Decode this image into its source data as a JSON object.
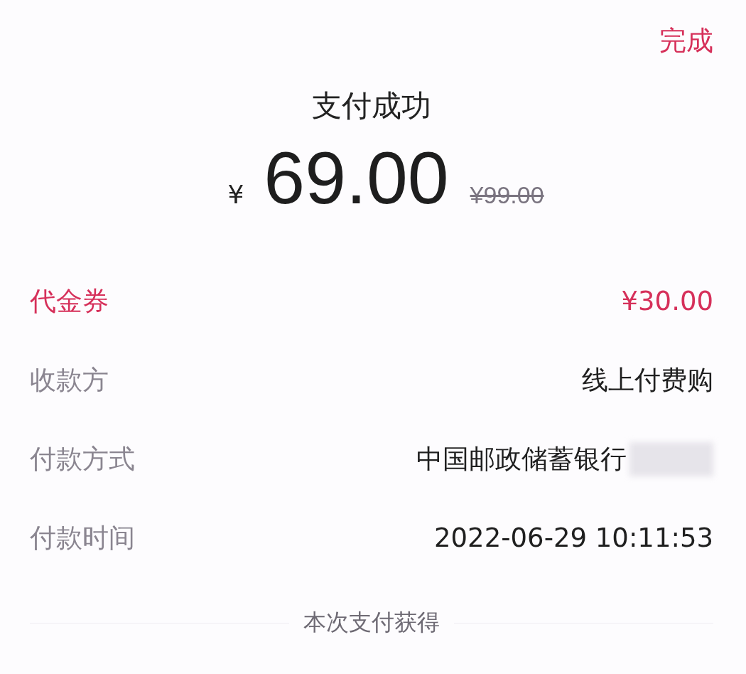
{
  "header": {
    "done_button": "完成",
    "title": "支付成功"
  },
  "amount": {
    "currency": "¥",
    "value": "69.00",
    "original_price": "¥99.00"
  },
  "details": [
    {
      "kind": "discount",
      "label": "代金券",
      "value": "¥30.00",
      "redacted": false
    },
    {
      "kind": "plain",
      "label": "收款方",
      "value": "线上付费购",
      "redacted": false
    },
    {
      "kind": "plain",
      "label": "付款方式",
      "value": "中国邮政储蓄银行",
      "redacted": true
    },
    {
      "kind": "plain",
      "label": "付款时间",
      "value": "2022-06-29 10:11:53",
      "redacted": false
    }
  ],
  "rewards": {
    "heading": "本次支付获得"
  }
}
